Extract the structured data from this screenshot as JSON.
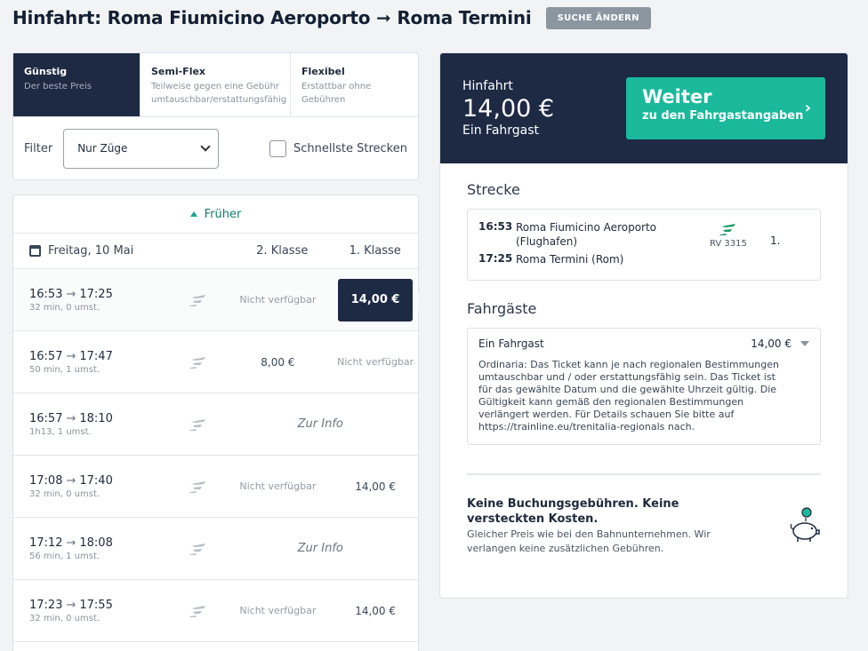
{
  "header": {
    "title": "Hinfahrt: Roma Fiumicino Aeroporto ➞ Roma Termini",
    "change_button": "SUCHE ÄNDERN"
  },
  "fare_tabs": [
    {
      "title": "Günstig",
      "subtitle": "Der beste Preis"
    },
    {
      "title": "Semi-Flex",
      "subtitle": "Teilweise gegen eine Gebühr umtauschbar/erstattungsfähig"
    },
    {
      "title": "Flexibel",
      "subtitle": "Erstattbar ohne Gebühren"
    }
  ],
  "filter": {
    "label": "Filter",
    "selected": "Nur Züge",
    "checkbox_label": "Schnellste Strecken"
  },
  "list": {
    "earlier_label": "Früher",
    "date": "Freitag, 10 Mai",
    "col2_header": "2. Klasse",
    "col1_header": "1. Klasse",
    "rows": [
      {
        "dep": "16:53",
        "arr": "17:25",
        "sub": "32 min, 0 umst.",
        "second": "Nicht verfügbar",
        "first": "14,00 €"
      },
      {
        "dep": "16:57",
        "arr": "17:47",
        "sub": "50 min, 1 umst.",
        "second": "8,00 €",
        "first": "Nicht verfügbar"
      },
      {
        "dep": "16:57",
        "arr": "18:10",
        "sub": "1h13, 1 umst.",
        "info": "Zur Info"
      },
      {
        "dep": "17:08",
        "arr": "17:40",
        "sub": "32 min, 0 umst.",
        "second": "Nicht verfügbar",
        "first": "14,00 €"
      },
      {
        "dep": "17:12",
        "arr": "18:08",
        "sub": "56 min, 1 umst.",
        "info": "Zur Info"
      },
      {
        "dep": "17:23",
        "arr": "17:55",
        "sub": "32 min, 0 umst.",
        "second": "Nicht verfügbar",
        "first": "14,00 €"
      }
    ]
  },
  "summary": {
    "direction": "Hinfahrt",
    "amount": "14,00 €",
    "passengers": "Ein Fahrgast",
    "continue_big": "Weiter",
    "continue_small": "zu den Fahrgastangaben"
  },
  "route": {
    "title": "Strecke",
    "dep_time": "16:53",
    "dep_station": "Roma Fiumicino Aeroporto (Flughafen)",
    "arr_time": "17:25",
    "arr_station": "Roma Termini (Rom)",
    "train": "RV 3315",
    "class": "1."
  },
  "pax": {
    "title": "Fahrgäste",
    "name": "Ein Fahrgast",
    "price": "14,00 €",
    "text": "Ordinaria: Das Ticket kann je nach regionalen Bestimmungen umtauschbar und / oder erstattungsfähig sein. Das Ticket ist für das gewählte Datum und die gewählte Uhrzeit gültig. Die Gültigkeit kann gemäß den regionalen Bestimmungen verlängert werden. Für Details schauen Sie bitte auf https://trainline.eu/trenitalia-regionals nach."
  },
  "nofee": {
    "heading": "Keine Buchungsgebühren. Keine versteckten Kosten.",
    "text": "Gleicher Preis wie bei den Bahnunternehmen. Wir verlangen keine zusätzlichen Gebühren."
  },
  "colors": {
    "navy": "#1e2a44",
    "teal": "#1ab99c",
    "teal_text": "#107e6c"
  }
}
